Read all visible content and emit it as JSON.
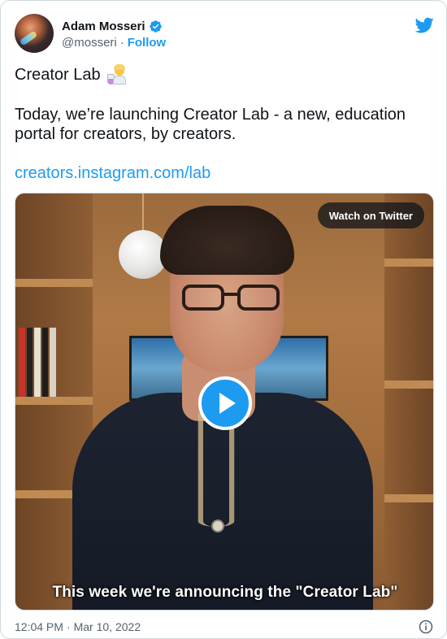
{
  "author": {
    "name": "Adam Mosseri",
    "handle": "@mosseri",
    "separator": "·",
    "follow_label": "Follow"
  },
  "tweet": {
    "title": "Creator Lab",
    "title_emoji": "scientist-emoji",
    "body": "Today, we’re launching Creator Lab - a new, education portal for creators, by creators.",
    "link": "creators.instagram.com/lab"
  },
  "media": {
    "watch_label": "Watch on Twitter",
    "caption": "This week we're announcing the \"Creator Lab\"",
    "play_icon": "play-icon"
  },
  "footer": {
    "time": "12:04 PM",
    "separator": "·",
    "date": "Mar 10, 2022",
    "info_icon": "info-icon"
  },
  "icons": {
    "verified": "verified-badge-icon",
    "brand": "twitter-bird-icon"
  },
  "colors": {
    "accent": "#1d9bf0",
    "text": "#0f1419",
    "muted": "#536471"
  }
}
